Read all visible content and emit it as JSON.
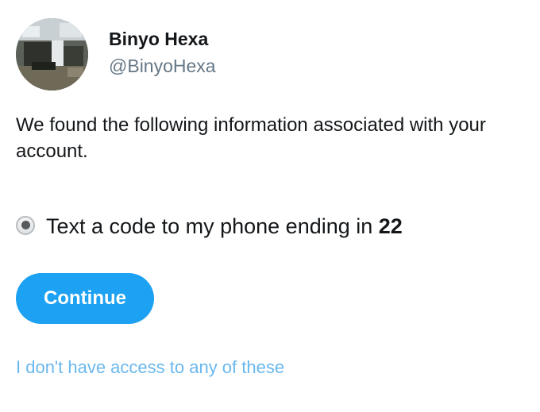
{
  "profile": {
    "name": "Binyo Hexa",
    "handle": "@BinyoHexa"
  },
  "info_text": "We found the following information associated with your account.",
  "option": {
    "label_prefix": "Text a code to my phone ending in ",
    "phone_suffix": "22",
    "selected": true
  },
  "continue_label": "Continue",
  "no_access_link": "I don't have access to any of these",
  "colors": {
    "accent": "#1da1f2",
    "link": "#6ab8ee",
    "handle": "#657786"
  }
}
